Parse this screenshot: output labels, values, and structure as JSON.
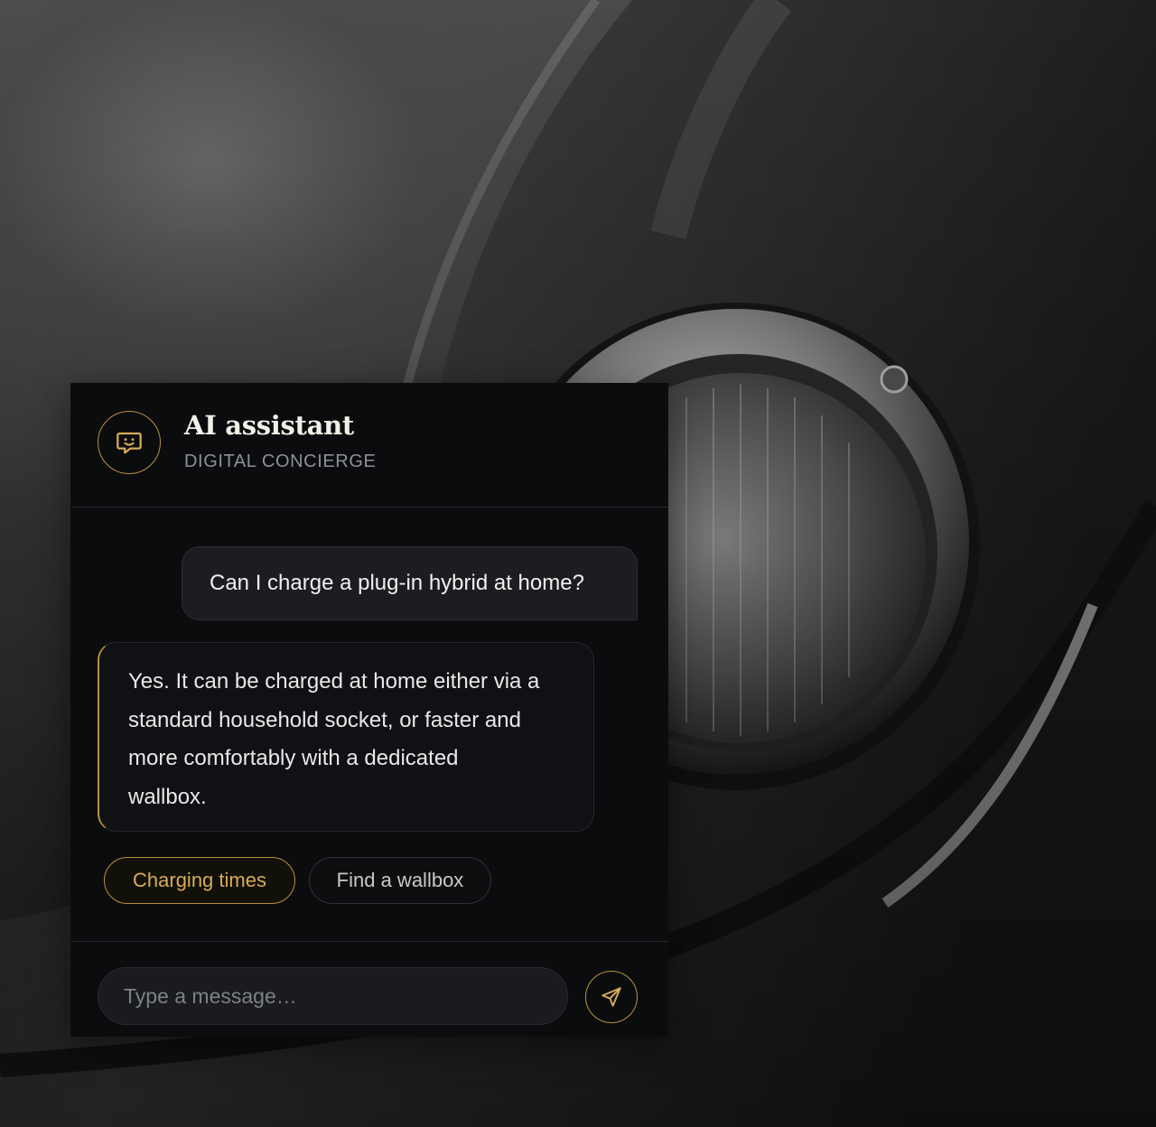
{
  "colors": {
    "accent_gold": "#b8923f",
    "panel_bg": "#0b0c0e",
    "chip_gold_text": "#d7ac58"
  },
  "background": {
    "icon": "car-headlight-photo"
  },
  "header": {
    "title": "AI assistant",
    "subtitle": "DIGITAL CONCIERGE",
    "avatar_icon": "chat-smile-icon"
  },
  "messages": {
    "user": "Can I charge a plug-in hybrid at home?",
    "assistant_lines": [
      "Yes. It can be charged at home either via a",
      "standard household socket, or faster and",
      "more comfortably with a dedicated",
      "wallbox."
    ]
  },
  "suggestions": [
    "Charging times",
    "Find a wallbox"
  ],
  "composer": {
    "placeholder": "Type a message…",
    "send_icon": "send-icon"
  }
}
